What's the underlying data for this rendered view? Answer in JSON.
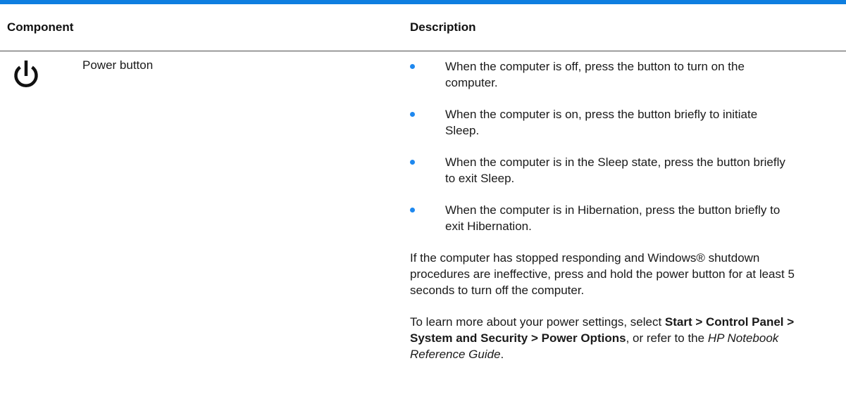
{
  "table": {
    "headers": {
      "component": "Component",
      "description": "Description"
    },
    "row": {
      "icon": "power-icon",
      "name": "Power button",
      "bullets": [
        "When the computer is off, press the button to turn on the computer.",
        "When the computer is on, press the button briefly to initiate Sleep.",
        "When the computer is in the Sleep state, press the button briefly to exit Sleep.",
        "When the computer is in Hibernation, press the button briefly to exit Hibernation."
      ],
      "paragraph1": "If the computer has stopped responding and Windows® shutdown procedures are ineffective, press and hold the power button for at least 5 seconds to turn off the computer.",
      "paragraph2": {
        "prefix": "To learn more about your power settings, select ",
        "path": "Start > Control Panel > System and Security > Power Options",
        "middle": ", or refer to the ",
        "guide": "HP Notebook Reference Guide",
        "suffix": "."
      }
    }
  },
  "colors": {
    "rule": "#0e7ee0",
    "bullet": "#1e88ef"
  }
}
